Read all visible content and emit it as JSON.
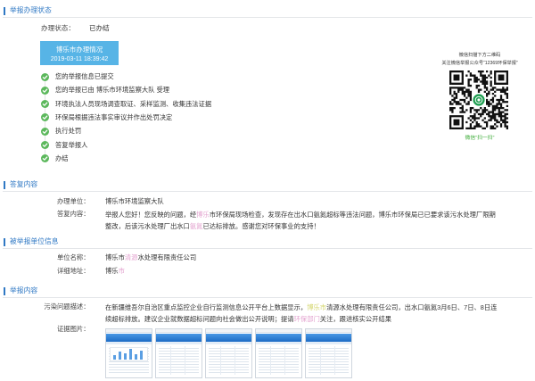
{
  "colors": {
    "accent": "#2f78c4",
    "step_done": "#5cb85c",
    "status_box": "#57b4e6",
    "scan_caption": "#3aaa35"
  },
  "icons": {
    "step_done": "check-circle-icon"
  },
  "status": {
    "title": "举报办理状态",
    "label": "办理状态：",
    "value": "已办结",
    "box_title": "博乐市办理情况",
    "box_time": "2019-03-11 18:39:42",
    "steps": [
      "您的举报信息已提交",
      "您的举报已由 博乐市环境监察大队 受理",
      "环境执法人员现场调查取证、采样监测、收集违法证据",
      "环保局根据违法事实审议并作出处罚决定",
      "执行处罚",
      "答复举报人",
      "办结"
    ]
  },
  "qr_panel": {
    "line1": "微信扫描下方二维码",
    "line2": "关注微信举报公众号“12369环保举报”",
    "caption": "微信“扫一扫”"
  },
  "reply": {
    "title": "答复内容",
    "unit_label": "办理单位：",
    "unit_value": "博乐市环境监察大队",
    "content_label": "答复内容：",
    "content_lines": [
      [
        "举报人您好！您反映的问题，经",
        "博乐",
        "市环保局现场检查，发现存在出水口氨氮超标等违法问题，博乐市环保局已已要求该污水处理厂限期"
      ],
      [
        "整改，后该污水处理厂出水口",
        "氨氮",
        "已达标排放。感谢您对环保事业的支持！"
      ]
    ]
  },
  "reported_unit": {
    "title": "被举报单位信息",
    "name_label": "单位名称：",
    "name_parts": [
      "博乐市",
      "清源",
      "水处理有限责任公司"
    ],
    "address_label": "详细地址：",
    "address_parts": [
      "博乐",
      "市"
    ]
  },
  "report": {
    "title": "举报内容",
    "description_label": "污染问题描述：",
    "description_lines": [
      [
        "在新疆维吾尔自治区重点监控企业自行监测信息公开平台上数据显示，",
        "博乐市",
        "清源水处理有限责任公司，出水口氨氮3月6日、7日、8日连"
      ],
      [
        "续超标排放。建议企业就数据超标问题向社会做出公开说明；提请",
        "环保部门",
        "关注，跟进核实公开结果"
      ]
    ],
    "evidence_label": "证据图片："
  }
}
